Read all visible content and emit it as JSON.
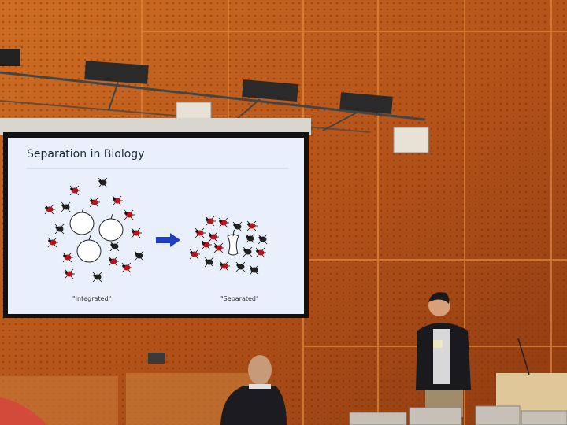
{
  "slide": {
    "title": "Separation in Biology",
    "caption_left": "\"Integrated\"",
    "caption_right": "\"Separated\""
  },
  "colors": {
    "wall": "#c3621f",
    "screen": "#e9f0fb",
    "arrow": "#1f3fbf",
    "bug_red": "#b4141c"
  }
}
